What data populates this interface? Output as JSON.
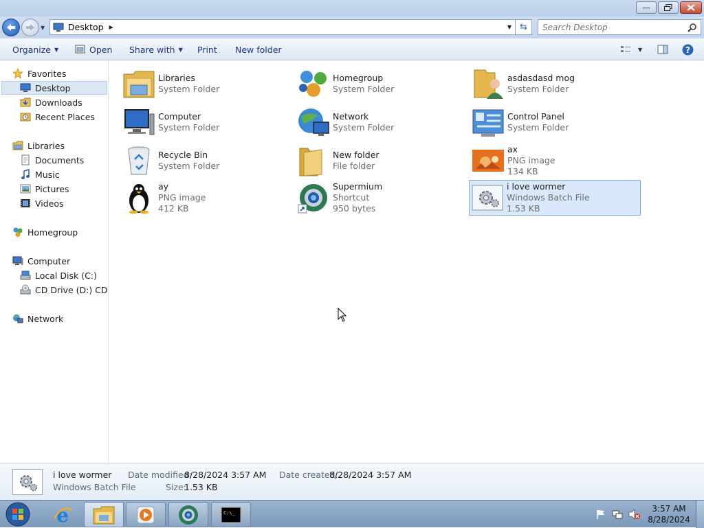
{
  "window": {
    "title": ""
  },
  "address": {
    "location": "Desktop",
    "back_icon": "back-arrow-icon",
    "forward_icon": "forward-arrow-icon"
  },
  "search": {
    "placeholder": "Search Desktop"
  },
  "toolbar": {
    "organize_label": "Organize",
    "open_label": "Open",
    "share_label": "Share with",
    "print_label": "Print",
    "newfolder_label": "New folder"
  },
  "sidebar": {
    "favorites": {
      "label": "Favorites",
      "items": [
        {
          "label": "Desktop",
          "icon": "desktop-icon",
          "selected": true
        },
        {
          "label": "Downloads",
          "icon": "downloads-icon"
        },
        {
          "label": "Recent Places",
          "icon": "recent-places-icon"
        }
      ]
    },
    "libraries": {
      "label": "Libraries",
      "items": [
        {
          "label": "Documents",
          "icon": "documents-icon"
        },
        {
          "label": "Music",
          "icon": "music-icon"
        },
        {
          "label": "Pictures",
          "icon": "pictures-icon"
        },
        {
          "label": "Videos",
          "icon": "videos-icon"
        }
      ]
    },
    "homegroup": {
      "label": "Homegroup"
    },
    "computer": {
      "label": "Computer",
      "items": [
        {
          "label": "Local Disk (C:)",
          "icon": "local-disk-icon"
        },
        {
          "label": "CD Drive (D:) CDROM",
          "icon": "cd-drive-icon"
        }
      ]
    },
    "network": {
      "label": "Network"
    }
  },
  "files": [
    {
      "name": "Libraries",
      "type": "System Folder",
      "size": "",
      "icon": "libraries-folder-icon"
    },
    {
      "name": "Homegroup",
      "type": "System Folder",
      "size": "",
      "icon": "homegroup-icon"
    },
    {
      "name": "asdasdasd mog",
      "type": "System Folder",
      "size": "",
      "icon": "user-folder-icon"
    },
    {
      "name": "Computer",
      "type": "System Folder",
      "size": "",
      "icon": "computer-icon"
    },
    {
      "name": "Network",
      "type": "System Folder",
      "size": "",
      "icon": "network-globe-icon"
    },
    {
      "name": "Control Panel",
      "type": "System Folder",
      "size": "",
      "icon": "control-panel-icon"
    },
    {
      "name": "Recycle Bin",
      "type": "System Folder",
      "size": "",
      "icon": "recycle-bin-icon"
    },
    {
      "name": "New folder",
      "type": "File folder",
      "size": "",
      "icon": "folder-icon"
    },
    {
      "name": "ax",
      "type": "PNG image",
      "size": "134 KB",
      "icon": "image-thumbnail-icon"
    },
    {
      "name": "ay",
      "type": "PNG image",
      "size": "412 KB",
      "icon": "penguin-thumbnail-icon"
    },
    {
      "name": "Supermium",
      "type": "Shortcut",
      "size": "950 bytes",
      "icon": "supermium-icon"
    },
    {
      "name": "i love wormer",
      "type": "Windows Batch File",
      "size": "1.53 KB",
      "icon": "batch-file-gear-icon",
      "selected": true
    }
  ],
  "details": {
    "name": "i love wormer",
    "type": "Windows Batch File",
    "modified_label": "Date modified:",
    "modified_value": "8/28/2024 3:57 AM",
    "created_label": "Date created:",
    "created_value": "8/28/2024 3:57 AM",
    "size_label": "Size:",
    "size_value": "1.53 KB"
  },
  "taskbar": {
    "time": "3:57 AM",
    "date": "8/28/2024",
    "apps": [
      "start-orb-icon",
      "internet-explorer-icon",
      "explorer-icon",
      "media-player-icon",
      "supermium-icon",
      "cmd-icon"
    ]
  },
  "colors": {
    "selection": "#d9e8fa",
    "selection_border": "#84acdd",
    "link_text": "#1e3287"
  }
}
